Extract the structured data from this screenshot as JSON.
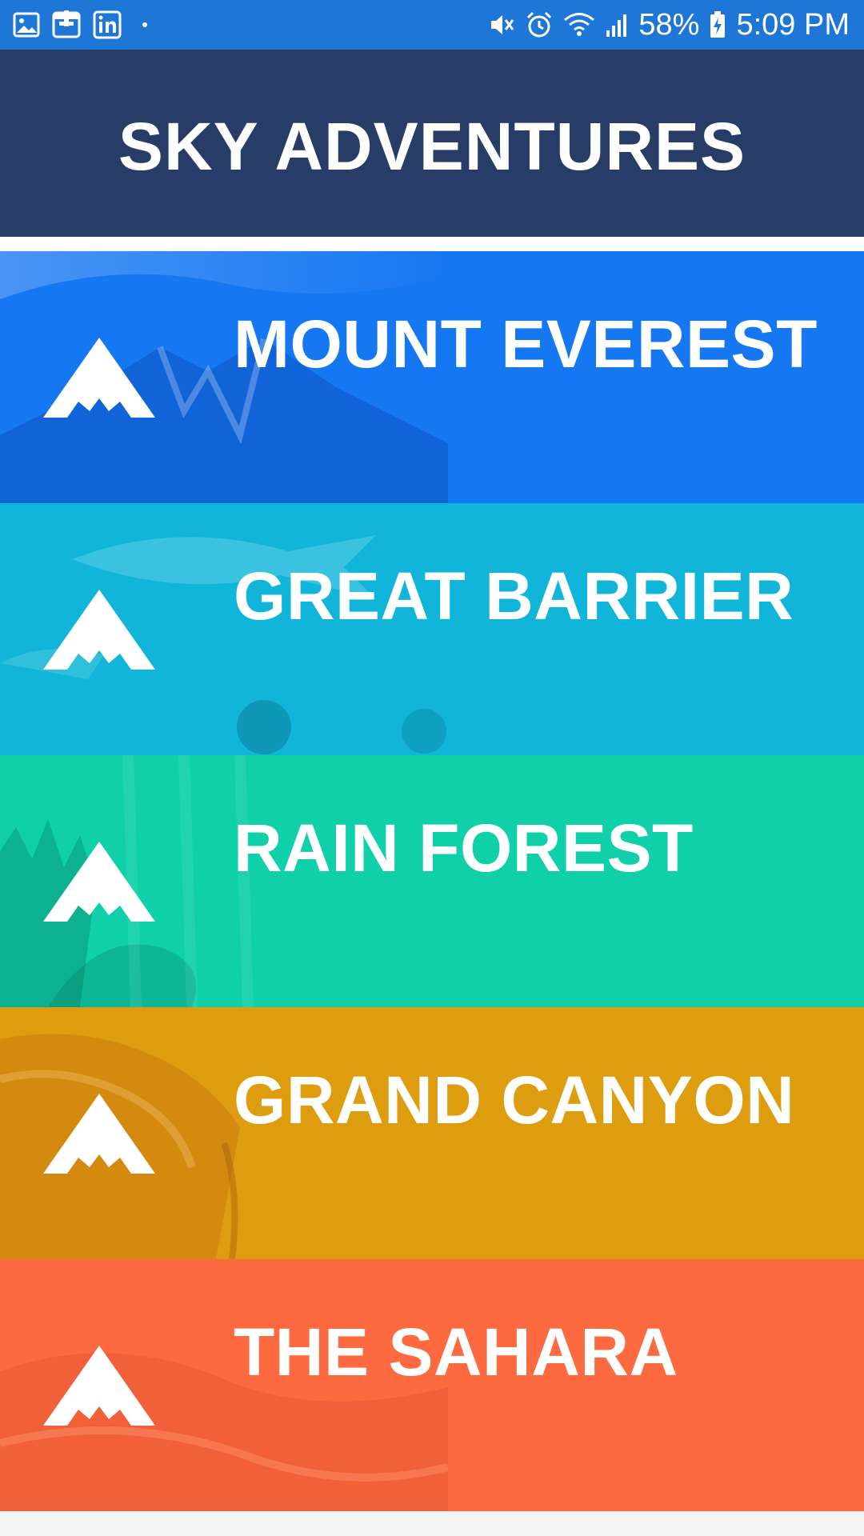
{
  "status_bar": {
    "icons_left": [
      "gallery-icon",
      "calendar-app-icon",
      "linkedin-icon",
      "notification-dot"
    ],
    "icons_right": [
      "mute-icon",
      "alarm-icon",
      "wifi-icon",
      "signal-icon"
    ],
    "battery_percent": "58%",
    "battery_icon": "battery-charging-icon",
    "time": "5:09 PM",
    "background": "#1e76d6"
  },
  "header": {
    "title": "SKY ADVENTURES",
    "background": "#273d68"
  },
  "destinations": [
    {
      "name": "MOUNT EVEREST",
      "color": "#1677f2",
      "icon": "mountain-icon"
    },
    {
      "name": "GREAT BARRIER",
      "color": "#10b5d9",
      "icon": "mountain-icon"
    },
    {
      "name": "RAIN FOREST",
      "color": "#10d0aa",
      "icon": "mountain-icon"
    },
    {
      "name": "GRAND CANYON",
      "color": "#de9c0f",
      "icon": "mountain-icon"
    },
    {
      "name": "THE SAHARA",
      "color": "#fe6a40",
      "icon": "mountain-icon"
    }
  ]
}
